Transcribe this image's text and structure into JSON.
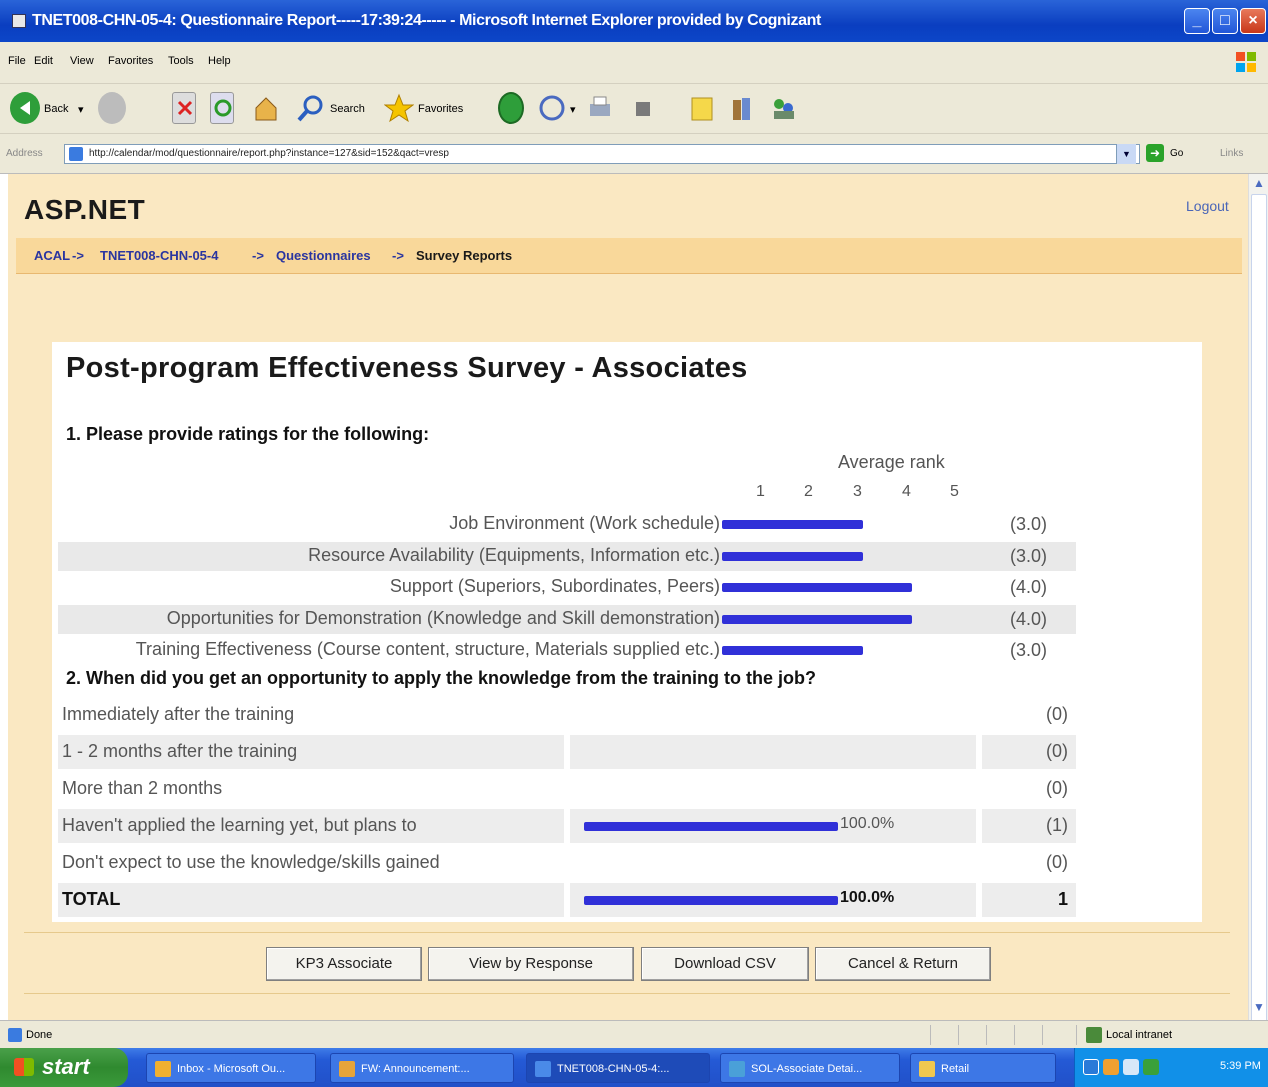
{
  "window": {
    "title": "TNET008-CHN-05-4: Questionnaire Report-----17:39:24----- - Microsoft Internet Explorer provided by Cognizant",
    "controls": [
      "minimize",
      "maximize",
      "close"
    ]
  },
  "menu": [
    "File",
    "Edit",
    "View",
    "Favorites",
    "Tools",
    "Help"
  ],
  "toolbar": {
    "back": "Back",
    "search": "Search",
    "favorites": "Favorites"
  },
  "address": {
    "label": "Address",
    "url": "http://calendar/mod/questionnaire/report.php?instance=127&sid=152&qact=vresp",
    "go": "Go",
    "links": "Links"
  },
  "page": {
    "site_title": "ASP.NET",
    "logout": "Logout",
    "breadcrumb": [
      "ACAL",
      "TNET008-CHN-05-4",
      "Questionnaires",
      "Survey Reports"
    ],
    "breadcrumb_sep": "->"
  },
  "survey": {
    "title": "Post-program Effectiveness Survey - Associates",
    "q1": {
      "heading": "1. Please provide ratings for the following:",
      "scale_title": "Average rank",
      "scale": [
        "1",
        "2",
        "3",
        "4",
        "5"
      ],
      "items": [
        {
          "label": "Job Environment (Work schedule)",
          "value": 3.0,
          "display": "(3.0)"
        },
        {
          "label": "Resource Availability (Equipments, Information etc.)",
          "value": 3.0,
          "display": "(3.0)"
        },
        {
          "label": "Support (Superiors, Subordinates, Peers)",
          "value": 4.0,
          "display": "(4.0)"
        },
        {
          "label": "Opportunities for Demonstration (Knowledge and Skill demonstration)",
          "value": 4.0,
          "display": "(4.0)"
        },
        {
          "label": "Training Effectiveness (Course content, structure, Materials supplied etc.)",
          "value": 3.0,
          "display": "(3.0)"
        }
      ]
    },
    "q2": {
      "heading": "2. When did you get an opportunity to apply the knowledge from the training to the job?",
      "responses": [
        {
          "label": "Immediately after the training",
          "percent": 0,
          "pct_text": "",
          "count": "(0)"
        },
        {
          "label": "1 - 2 months after the training",
          "percent": 0,
          "pct_text": "",
          "count": "(0)"
        },
        {
          "label": "More than 2 months",
          "percent": 0,
          "pct_text": "",
          "count": "(0)"
        },
        {
          "label": "Haven't applied the learning yet, but plans to",
          "percent": 100,
          "pct_text": "100.0%",
          "count": "(1)"
        },
        {
          "label": "Don't expect to use the knowledge/skills gained",
          "percent": 0,
          "pct_text": "",
          "count": "(0)"
        }
      ],
      "total": {
        "label": "TOTAL",
        "percent": 100,
        "pct_text": "100.0%",
        "count": "1"
      }
    }
  },
  "buttons": [
    "KP3 Associate",
    "View by Response",
    "Download CSV",
    "Cancel & Return"
  ],
  "status": {
    "text": "Done",
    "zone": "Local intranet"
  },
  "taskbar": {
    "start": "start",
    "tasks": [
      "Inbox - Microsoft Ou...",
      "FW: Announcement:...",
      "TNET008-CHN-05-4:...",
      "SOL-Associate Detai...",
      "Retail"
    ],
    "active_index": 2,
    "clock": "5:39 PM"
  },
  "colors": {
    "bar": "#3030d8",
    "page_bg": "#fae8c2",
    "breadcrumb_bg": "#f9d89a",
    "titlebar": "#0a3ec0"
  }
}
